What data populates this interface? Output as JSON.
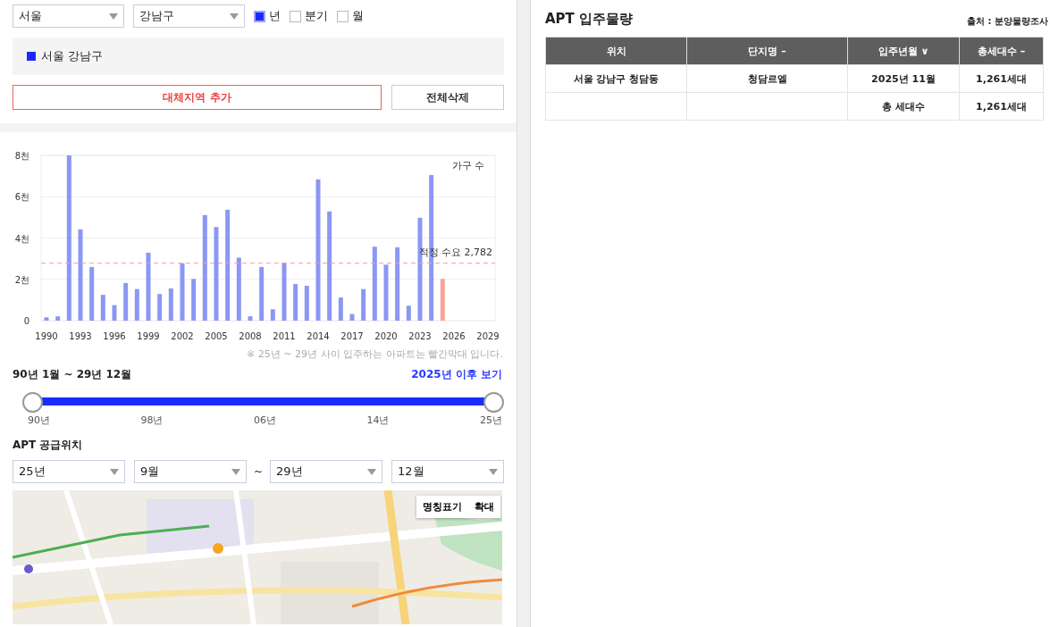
{
  "filters": {
    "city": "서울",
    "district": "강남구",
    "periods": [
      {
        "label": "년",
        "checked": true
      },
      {
        "label": "분기",
        "checked": false
      },
      {
        "label": "월",
        "checked": false
      }
    ]
  },
  "regions": [
    {
      "label": "서울 강남구",
      "color": "#1a2bff"
    }
  ],
  "buttons": {
    "add": "대체지역 추가",
    "clear": "전체삭제"
  },
  "chart": {
    "chart_data": {
      "type": "bar",
      "ylabel": "가구 수",
      "categories": [
        "1990",
        null,
        null,
        "1993",
        null,
        null,
        "1996",
        null,
        null,
        "1999",
        null,
        null,
        "2002",
        null,
        null,
        "2005",
        null,
        null,
        "2008",
        null,
        null,
        "2011",
        null,
        null,
        "2014",
        null,
        null,
        "2017",
        null,
        null,
        "2020",
        null,
        null,
        "2023",
        null,
        null,
        "2026",
        null,
        null,
        "2029"
      ],
      "series": [
        {
          "color": "#8b97f5",
          "values": [
            0.16,
            0.21,
            8.0,
            4.42,
            2.6,
            1.25,
            0.75,
            1.82,
            1.53,
            3.29,
            1.29,
            1.56,
            2.78,
            2.02,
            5.11,
            4.53,
            5.37,
            3.05,
            0.21,
            2.6,
            0.55,
            2.81,
            1.77,
            1.69,
            6.84,
            5.29,
            1.12,
            0.32,
            1.53,
            3.58,
            2.71,
            3.55,
            0.72,
            4.98,
            7.05,
            null,
            null,
            null,
            null,
            null
          ]
        },
        {
          "color": "#f7a49a",
          "values": [
            null,
            null,
            null,
            null,
            null,
            null,
            null,
            null,
            null,
            null,
            null,
            null,
            null,
            null,
            null,
            null,
            null,
            null,
            null,
            null,
            null,
            null,
            null,
            null,
            null,
            null,
            null,
            null,
            null,
            null,
            null,
            null,
            null,
            null,
            null,
            2.02,
            null,
            null,
            null,
            null
          ]
        }
      ],
      "ylim": [
        0,
        8
      ],
      "yticks": [
        0,
        {
          "value": 2,
          "label": "2천"
        },
        {
          "value": 4,
          "label": "4천"
        },
        {
          "value": 6,
          "label": "6천"
        },
        {
          "value": 8,
          "label": "8천"
        }
      ],
      "stacked": true,
      "grid": true,
      "ref_lines": [
        {
          "axis": "y",
          "value": 2.782,
          "label": "적정 수요 2,782"
        }
      ]
    },
    "note": "※ 25년 ~ 29년 사이 입주하는 아파트는 빨간막대 입니다."
  },
  "range": {
    "title": "90년 1월 ~ 29년 12월",
    "link": "2025년 이후 보기",
    "thumbs": [
      {
        "level": 0
      },
      {
        "level": 1
      }
    ],
    "ticks": [
      "90년",
      "98년",
      "06년",
      "14년",
      "25년"
    ]
  },
  "supply": {
    "title": "APT 공급위치",
    "from_year": "25년",
    "from_month": "9월",
    "separator": "~",
    "to_year": "29년",
    "to_month": "12월"
  },
  "map": {
    "kind": "picture",
    "buttons": [
      "명칭표기",
      "확대"
    ]
  },
  "table": {
    "title": "APT 입주물량",
    "source": "출처 : 분양물량조사",
    "columns": [
      "위치",
      "단지명 –",
      "입주년월 ∨",
      "총세대수 –"
    ],
    "rows": [
      [
        "서울 강남구 청담동",
        "청담르엘",
        "2025년 11월",
        "1,261세대"
      ]
    ],
    "total": {
      "label": "총 세대수",
      "value": "1,261세대"
    }
  }
}
